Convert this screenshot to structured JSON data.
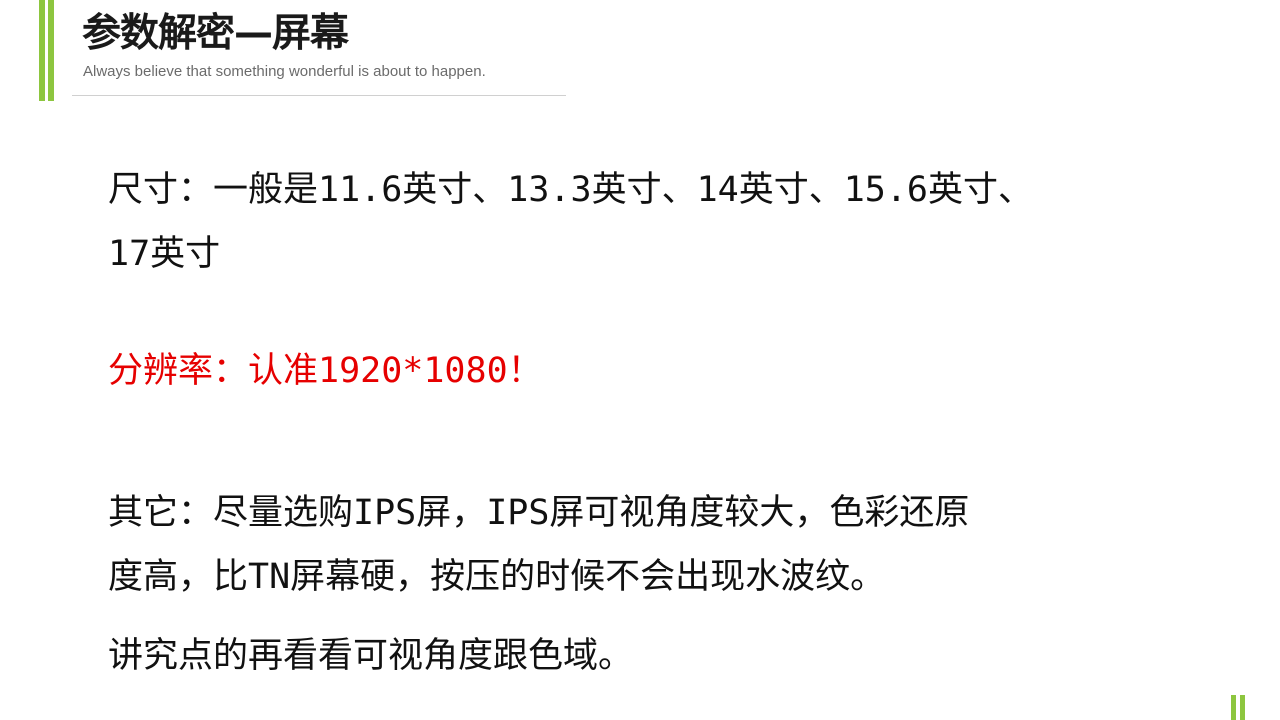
{
  "header": {
    "title": "参数解密—屏幕",
    "subtitle": "Always believe that something wonderful is about to happen."
  },
  "content": {
    "size": {
      "line1": "尺寸：一般是11.6英寸、13.3英寸、14英寸、15.6英寸、",
      "line2": "17英寸"
    },
    "resolution": {
      "text": "分辨率：认准1920*1080！",
      "color": "#e60000"
    },
    "other": {
      "line1": "其它：尽量选购IPS屏，IPS屏可视角度较大，色彩还原",
      "line2": "度高，比TN屏幕硬，按压的时候不会出现水波纹。"
    },
    "note": {
      "text": "讲究点的再看看可视角度跟色域。"
    }
  },
  "colors": {
    "accent_green": "#8dc63f",
    "text": "#111111",
    "subtitle": "#6b6b6b"
  }
}
